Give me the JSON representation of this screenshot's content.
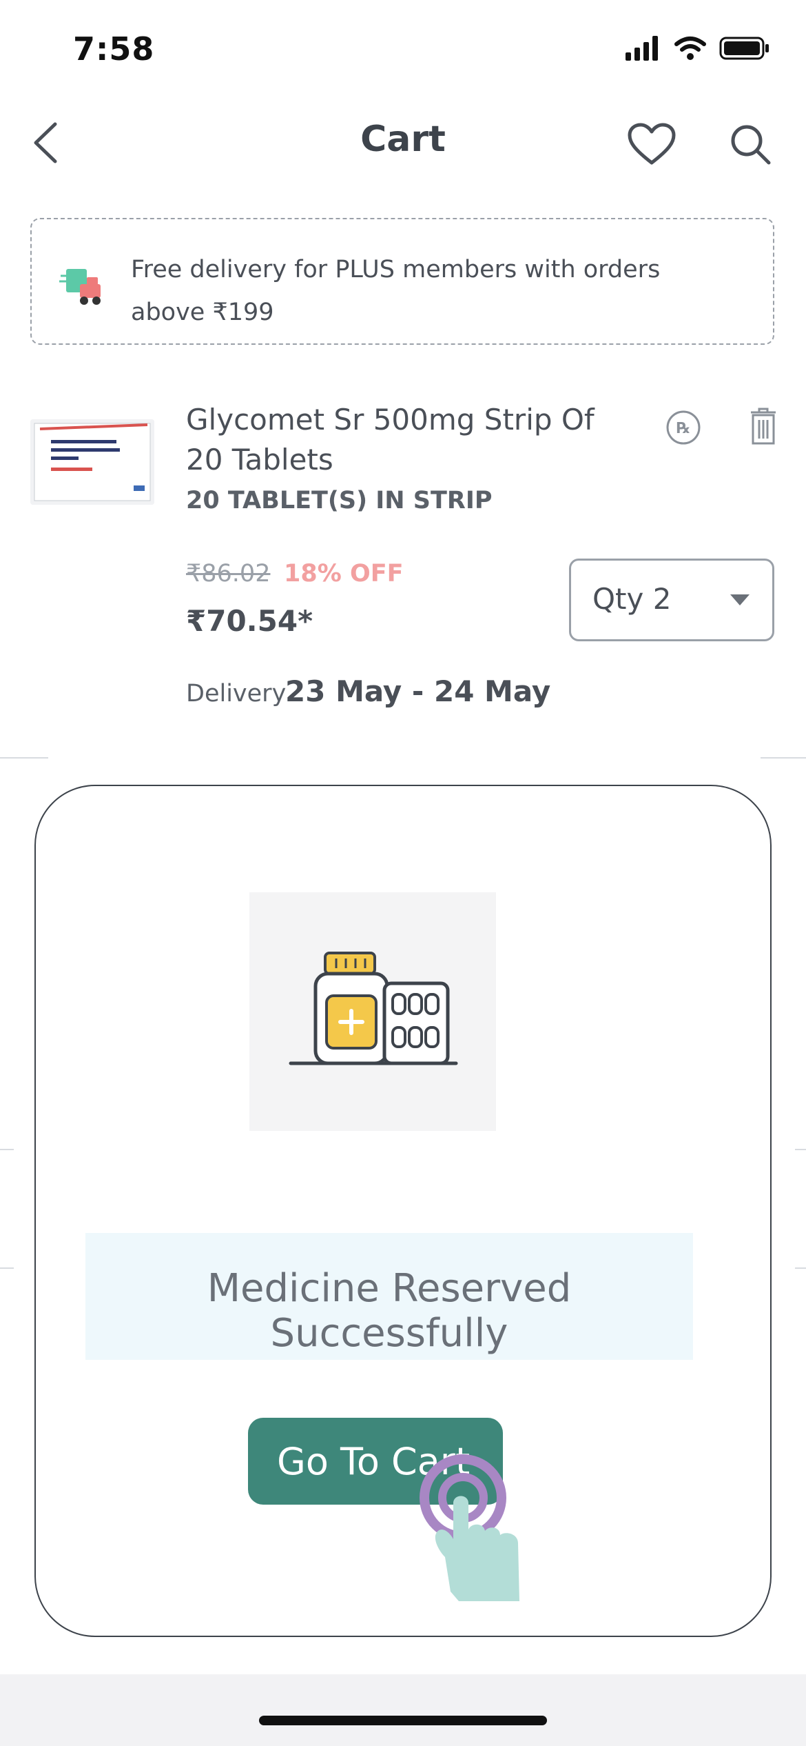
{
  "status_bar": {
    "time": "7:58"
  },
  "header": {
    "title": "Cart"
  },
  "banner": {
    "text": "Free delivery for PLUS members with orders above ₹199"
  },
  "product": {
    "name": "Glycomet Sr 500mg Strip Of 20 Tablets",
    "pack_size": "20 TABLET(S) IN STRIP",
    "mrp": "₹86.02",
    "discount": "18% OFF",
    "price": "₹70.54*",
    "quantity_label": "Qty 2",
    "delivery_label": "Delivery",
    "delivery_date": "23 May - 24 May"
  },
  "modal": {
    "message": "Medicine Reserved Successfully",
    "button_label": "Go To Cart"
  },
  "colors": {
    "accent": "#3e877a",
    "discount": "#f2a0a0",
    "success_bg": "#eef8fc"
  }
}
